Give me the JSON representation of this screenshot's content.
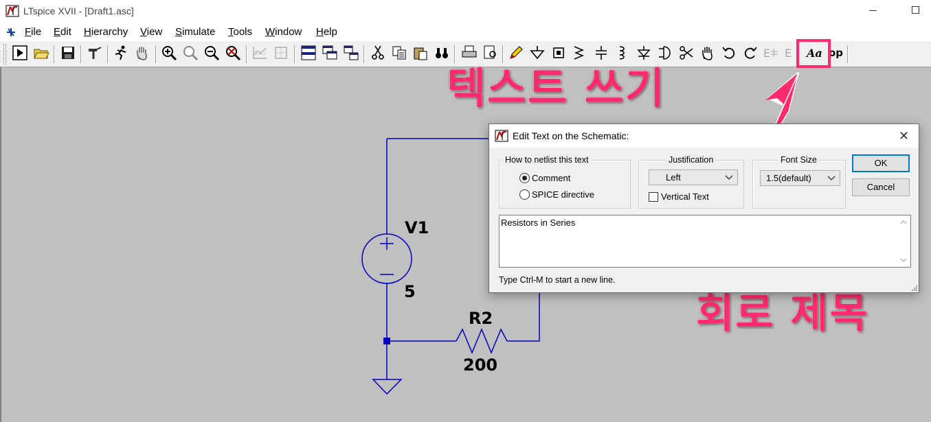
{
  "window": {
    "title": "LTspice XVII - [Draft1.asc]"
  },
  "menu": {
    "items": [
      {
        "key": "F",
        "rest": "ile"
      },
      {
        "key": "E",
        "rest": "dit"
      },
      {
        "key": "H",
        "rest": "ierarchy"
      },
      {
        "key": "V",
        "rest": "iew"
      },
      {
        "key": "S",
        "rest": "imulate"
      },
      {
        "key": "T",
        "rest": "ools"
      },
      {
        "key": "W",
        "rest": "indow"
      },
      {
        "key": "H",
        "rest": "elp"
      }
    ]
  },
  "toolbar": {
    "text_tool_label": "Aa",
    "spice_op_label": "op",
    "label_tool": "E"
  },
  "schematic": {
    "v1_name": "V1",
    "v1_value": "5",
    "r2_name": "R2",
    "r2_value": "200",
    "wire_color": "#0000c0"
  },
  "annotations": {
    "text_tool": "텍스트 쓰기",
    "circuit_title": "회로 제목",
    "color": "#ff2a6d"
  },
  "dialog": {
    "title": "Edit Text on the Schematic:",
    "netlist_group": "How to netlist this text",
    "radio_comment": "Comment",
    "radio_spice": "SPICE directive",
    "justification_group": "Justification",
    "justification_value": "Left",
    "vertical_text": "Vertical Text",
    "font_size_group": "Font Size",
    "font_size_value": "1.5(default)",
    "ok": "OK",
    "cancel": "Cancel",
    "text_value": "Resistors in Series",
    "hint": "Type Ctrl-M to start a new line."
  }
}
